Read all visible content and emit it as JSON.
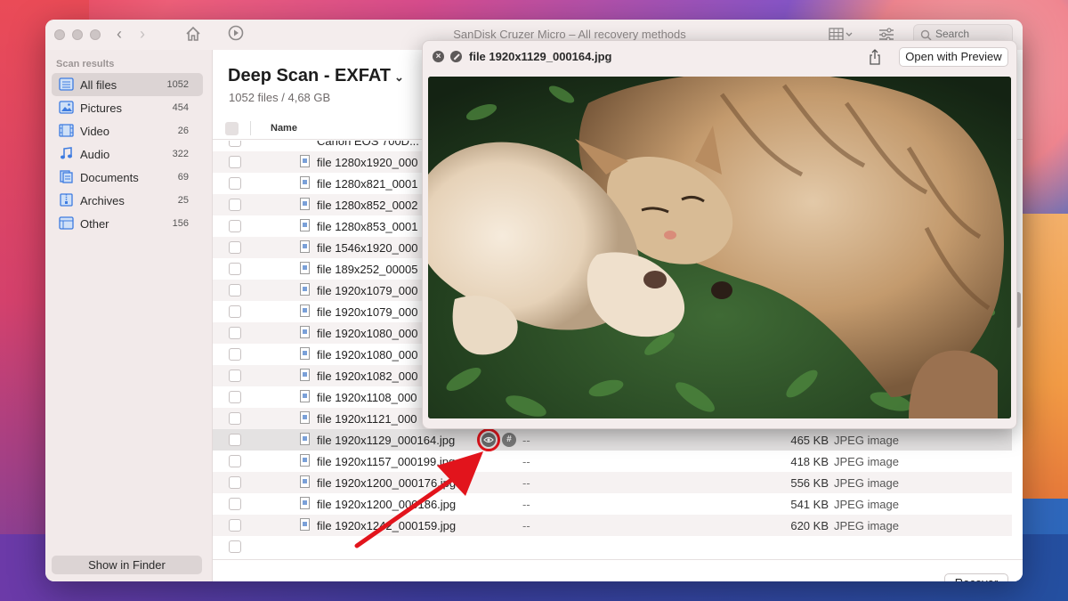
{
  "window": {
    "title": "SanDisk Cruzer Micro – All recovery methods",
    "search_placeholder": "Search"
  },
  "sidebar": {
    "heading": "Scan results",
    "items": [
      {
        "label": "All files",
        "count": "1052",
        "icon": "all-files-icon"
      },
      {
        "label": "Pictures",
        "count": "454",
        "icon": "pictures-icon"
      },
      {
        "label": "Video",
        "count": "26",
        "icon": "video-icon"
      },
      {
        "label": "Audio",
        "count": "322",
        "icon": "audio-icon"
      },
      {
        "label": "Documents",
        "count": "69",
        "icon": "documents-icon"
      },
      {
        "label": "Archives",
        "count": "25",
        "icon": "archives-icon"
      },
      {
        "label": "Other",
        "count": "156",
        "icon": "other-icon"
      }
    ],
    "show_in_finder": "Show in Finder"
  },
  "main": {
    "title": "Deep Scan - EXFAT",
    "subtitle": "1052 files / 4,68 GB",
    "column_name": "Name",
    "recover_label": "Recover"
  },
  "rows": [
    {
      "name": "Canon EOS 700D...",
      "date": "",
      "size": "",
      "type": ""
    },
    {
      "name": "file 1280x1920_000",
      "date": "",
      "size": "",
      "type": ""
    },
    {
      "name": "file 1280x821_0001",
      "date": "",
      "size": "",
      "type": ""
    },
    {
      "name": "file 1280x852_0002",
      "date": "",
      "size": "",
      "type": ""
    },
    {
      "name": "file 1280x853_0001",
      "date": "",
      "size": "",
      "type": ""
    },
    {
      "name": "file 1546x1920_000",
      "date": "",
      "size": "",
      "type": ""
    },
    {
      "name": "file 189x252_00005",
      "date": "",
      "size": "",
      "type": ""
    },
    {
      "name": "file 1920x1079_000",
      "date": "",
      "size": "",
      "type": ""
    },
    {
      "name": "file 1920x1079_000",
      "date": "",
      "size": "",
      "type": ""
    },
    {
      "name": "file 1920x1080_000",
      "date": "",
      "size": "",
      "type": ""
    },
    {
      "name": "file 1920x1080_000",
      "date": "",
      "size": "",
      "type": ""
    },
    {
      "name": "file 1920x1082_000",
      "date": "",
      "size": "",
      "type": ""
    },
    {
      "name": "file 1920x1108_000",
      "date": "",
      "size": "",
      "type": ""
    },
    {
      "name": "file 1920x1121_000",
      "date": "",
      "size": "",
      "type": ""
    },
    {
      "name": "file 1920x1129_000164.jpg",
      "date": "--",
      "size": "465 KB",
      "type": "JPEG image"
    },
    {
      "name": "file 1920x1157_000199.jpg",
      "date": "--",
      "size": "418 KB",
      "type": "JPEG image"
    },
    {
      "name": "file 1920x1200_000176.jpg",
      "date": "--",
      "size": "556 KB",
      "type": "JPEG image"
    },
    {
      "name": "file 1920x1200_000186.jpg",
      "date": "--",
      "size": "541 KB",
      "type": "JPEG image"
    },
    {
      "name": "file 1920x1242_000159.jpg",
      "date": "--",
      "size": "620 KB",
      "type": "JPEG image"
    }
  ],
  "preview": {
    "title": "file 1920x1129_000164.jpg",
    "open_button": "Open with Preview"
  },
  "colors": {
    "annotation_red": "#e2141c"
  }
}
